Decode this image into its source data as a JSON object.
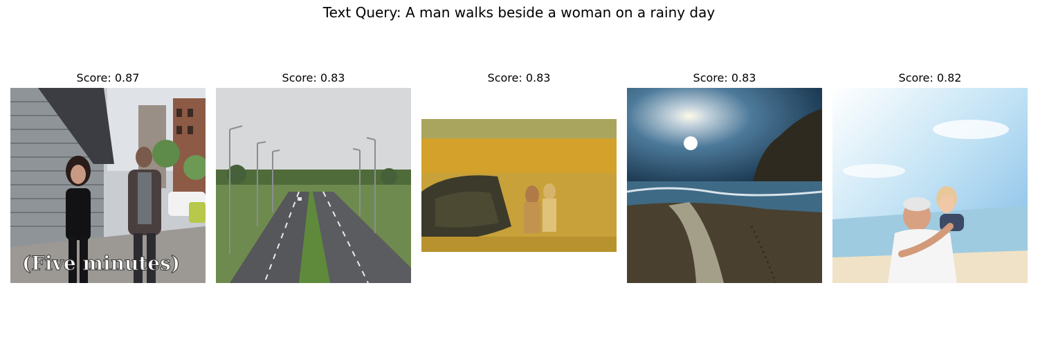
{
  "figure": {
    "title": "Text Query: A man walks beside a woman on a rainy day"
  },
  "results": [
    {
      "score_label": "Score: 0.87",
      "scene": "two people walking on a city sidewalk past shop shutters",
      "caption_overlay": "(Five minutes)"
    },
    {
      "score_label": "Score: 0.83",
      "scene": "divided highway under overcast sky with street lamps"
    },
    {
      "score_label": "Score: 0.83",
      "scene": "painting of two figures standing in a golden field"
    },
    {
      "score_label": "Score: 0.83",
      "scene": "sunlit beach with cliffs and footprints in the sand"
    },
    {
      "score_label": "Score: 0.82",
      "scene": "smiling man giving a woman a piggyback ride on a sunny beach"
    }
  ]
}
